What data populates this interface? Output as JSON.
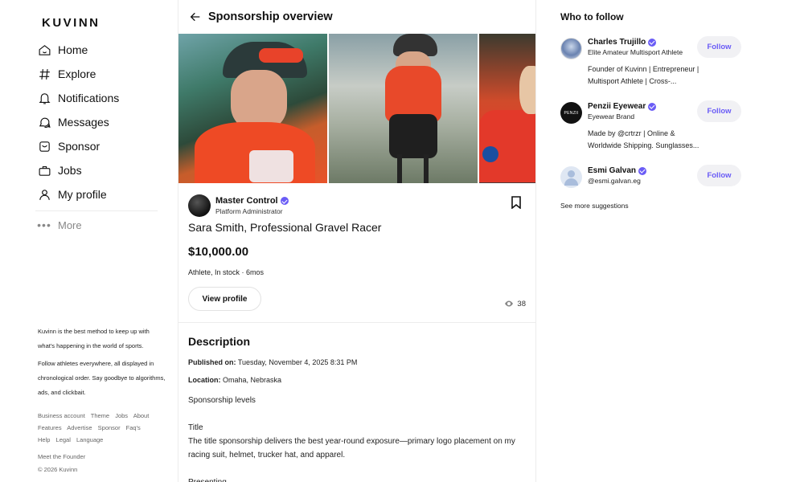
{
  "brand": {
    "logo_text": "KUVINN"
  },
  "nav": {
    "items": [
      {
        "label": "Home",
        "icon": "home-icon"
      },
      {
        "label": "Explore",
        "icon": "hashtag-icon"
      },
      {
        "label": "Notifications",
        "icon": "bell-icon"
      },
      {
        "label": "Messages",
        "icon": "messages-icon"
      },
      {
        "label": "Sponsor",
        "icon": "sponsor-icon"
      },
      {
        "label": "Jobs",
        "icon": "briefcase-icon"
      },
      {
        "label": "My profile",
        "icon": "user-icon"
      }
    ],
    "more_label": "More"
  },
  "about": {
    "line1": "Kuvinn is the best method to keep up with what's happening in the world of sports.",
    "line2": "Follow athletes everywhere, all displayed in chronological order. Say goodbye to algorithms, ads, and clickbait."
  },
  "footer": {
    "links": [
      "Business account",
      "Theme",
      "Jobs",
      "About",
      "Features",
      "Advertise",
      "Sponsor",
      "Faq's",
      "Help",
      "Legal",
      "Language"
    ],
    "founder": "Meet the Founder",
    "copyright": "© 2026 Kuvinn"
  },
  "main": {
    "title": "Sponsorship overview",
    "poster": {
      "name": "Master Control",
      "role": "Platform Administrator"
    },
    "listing_title": "Sara Smith, Professional Gravel Racer",
    "price": "$10,000.00",
    "meta": "Athlete, In stock · 6mos",
    "view_profile_label": "View profile",
    "views": "38",
    "description": {
      "heading": "Description",
      "published_label": "Published on:",
      "published_value": "Tuesday, November 4, 2025 8:31 PM",
      "location_label": "Location:",
      "location_value": "Omaha, Nebraska",
      "levels": "Sponsorship levels",
      "title_tier": "Title",
      "title_desc": "The title sponsorship delivers the best year-round exposure—primary logo placement on my racing suit, helmet, trucker hat, and apparel.",
      "presenting": "Presenting"
    }
  },
  "right": {
    "heading": "Who to follow",
    "suggestions": [
      {
        "name": "Charles Trujillo",
        "sub": "Elite Amateur Multisport Athlete",
        "bio": "Founder of Kuvinn | Entrepreneur | Multisport Athlete | Cross-...",
        "follow": "Follow"
      },
      {
        "name": "Penzii Eyewear",
        "sub": "Eyewear Brand",
        "bio": "Made by @crtrzr | Online & Worldwide Shipping. Sunglasses...",
        "follow": "Follow",
        "avatar_text": "PENZII"
      },
      {
        "name": "Esmi Galvan",
        "sub": "@esmi.galvan.eg",
        "bio": "",
        "follow": "Follow"
      }
    ],
    "see_more": "See more suggestions"
  },
  "colors": {
    "accent": "#6a5cf6",
    "border": "#ececec"
  }
}
